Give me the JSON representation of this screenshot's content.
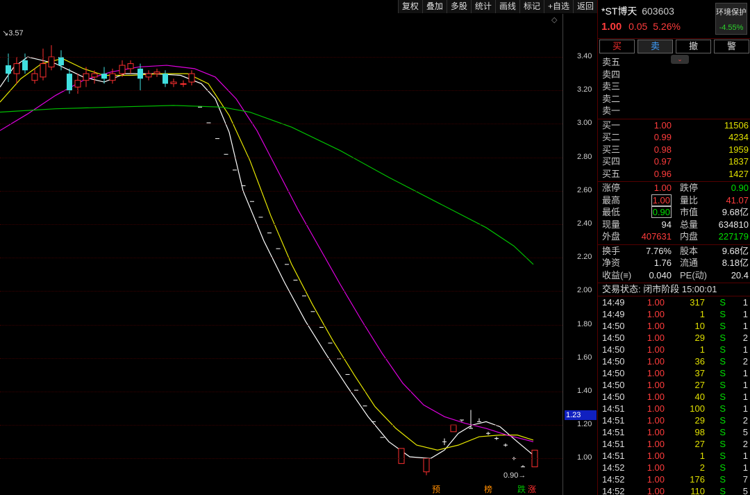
{
  "toolbar": {
    "items": [
      "复权",
      "叠加",
      "多股",
      "统计",
      "画线",
      "标记",
      "+自选",
      "返回"
    ]
  },
  "chart": {
    "y_ticks": [
      "3.40",
      "3.20",
      "3.00",
      "2.80",
      "2.60",
      "2.40",
      "2.20",
      "2.00",
      "1.80",
      "1.60",
      "1.40",
      "1.20",
      "1.00"
    ],
    "current_price_tag": "1.23",
    "high_label": "3.57",
    "low_label": "0.90",
    "markers": [
      {
        "text": "预",
        "color": "#ff8c00"
      },
      {
        "text": "榜",
        "color": "#ff8c00"
      },
      {
        "text": "跌",
        "color": "#00c000"
      },
      {
        "text": "涨",
        "color": "#ff3030"
      }
    ],
    "colors": {
      "ma5": "#ffffff",
      "ma10": "#e8e800",
      "ma20": "#e000e0",
      "ma60": "#00c000",
      "up": "#ff3030",
      "down": "#40e0e0"
    }
  },
  "stock": {
    "name": "*ST博天",
    "code": "603603",
    "price": "1.00",
    "change": "0.05",
    "change_pct": "5.26%",
    "env_label": "环境保护",
    "env_pct": "-4.55%"
  },
  "trade_buttons": [
    "买",
    "卖",
    "撤",
    "警"
  ],
  "sell_levels": [
    "卖五",
    "卖四",
    "卖三",
    "卖二",
    "卖一"
  ],
  "buy_levels": [
    {
      "label": "买一",
      "price": "1.00",
      "vol": "11506"
    },
    {
      "label": "买二",
      "price": "0.99",
      "vol": "4234"
    },
    {
      "label": "买三",
      "price": "0.98",
      "vol": "1959"
    },
    {
      "label": "买四",
      "price": "0.97",
      "vol": "1837"
    },
    {
      "label": "买五",
      "price": "0.96",
      "vol": "1427"
    }
  ],
  "stats": [
    {
      "l1": "涨停",
      "v1": "1.00",
      "c1": "red",
      "l2": "跌停",
      "v2": "0.90",
      "c2": "green"
    },
    {
      "l1": "最高",
      "v1": "1.00",
      "c1": "red",
      "b1": true,
      "l2": "量比",
      "v2": "41.07",
      "c2": "red"
    },
    {
      "l1": "最低",
      "v1": "0.90",
      "c1": "green",
      "b1": true,
      "l2": "市值",
      "v2": "9.68亿",
      "c2": "white"
    },
    {
      "l1": "现量",
      "v1": "94",
      "c1": "white",
      "l2": "总量",
      "v2": "634810",
      "c2": "white"
    },
    {
      "l1": "外盘",
      "v1": "407631",
      "c1": "red",
      "l2": "内盘",
      "v2": "227179",
      "c2": "green"
    }
  ],
  "stats2": [
    {
      "l1": "换手",
      "v1": "7.76%",
      "l2": "股本",
      "v2": "9.68亿"
    },
    {
      "l1": "净资",
      "v1": "1.76",
      "l2": "流通",
      "v2": "8.18亿"
    },
    {
      "l1": "收益(≡)",
      "v1": "0.040",
      "l2": "PE(动)",
      "v2": "20.4"
    }
  ],
  "trade_status": "交易状态: 闭市阶段 15:00:01",
  "ticks": [
    {
      "t": "14:49",
      "p": "1.00",
      "v": "317",
      "s": "S",
      "n": "1"
    },
    {
      "t": "14:49",
      "p": "1.00",
      "v": "1",
      "s": "S",
      "n": "1"
    },
    {
      "t": "14:50",
      "p": "1.00",
      "v": "10",
      "s": "S",
      "n": "1"
    },
    {
      "t": "14:50",
      "p": "1.00",
      "v": "29",
      "s": "S",
      "n": "2"
    },
    {
      "t": "14:50",
      "p": "1.00",
      "v": "1",
      "s": "S",
      "n": "1"
    },
    {
      "t": "14:50",
      "p": "1.00",
      "v": "36",
      "s": "S",
      "n": "2"
    },
    {
      "t": "14:50",
      "p": "1.00",
      "v": "37",
      "s": "S",
      "n": "1"
    },
    {
      "t": "14:50",
      "p": "1.00",
      "v": "27",
      "s": "S",
      "n": "1"
    },
    {
      "t": "14:50",
      "p": "1.00",
      "v": "40",
      "s": "S",
      "n": "1"
    },
    {
      "t": "14:51",
      "p": "1.00",
      "v": "100",
      "s": "S",
      "n": "1"
    },
    {
      "t": "14:51",
      "p": "1.00",
      "v": "29",
      "s": "S",
      "n": "2"
    },
    {
      "t": "14:51",
      "p": "1.00",
      "v": "98",
      "s": "S",
      "n": "5"
    },
    {
      "t": "14:51",
      "p": "1.00",
      "v": "27",
      "s": "S",
      "n": "2"
    },
    {
      "t": "14:51",
      "p": "1.00",
      "v": "1",
      "s": "S",
      "n": "1"
    },
    {
      "t": "14:52",
      "p": "1.00",
      "v": "2",
      "s": "S",
      "n": "1"
    },
    {
      "t": "14:52",
      "p": "1.00",
      "v": "176",
      "s": "S",
      "n": "7"
    },
    {
      "t": "14:52",
      "p": "1.00",
      "v": "110",
      "s": "S",
      "n": "5"
    }
  ]
}
